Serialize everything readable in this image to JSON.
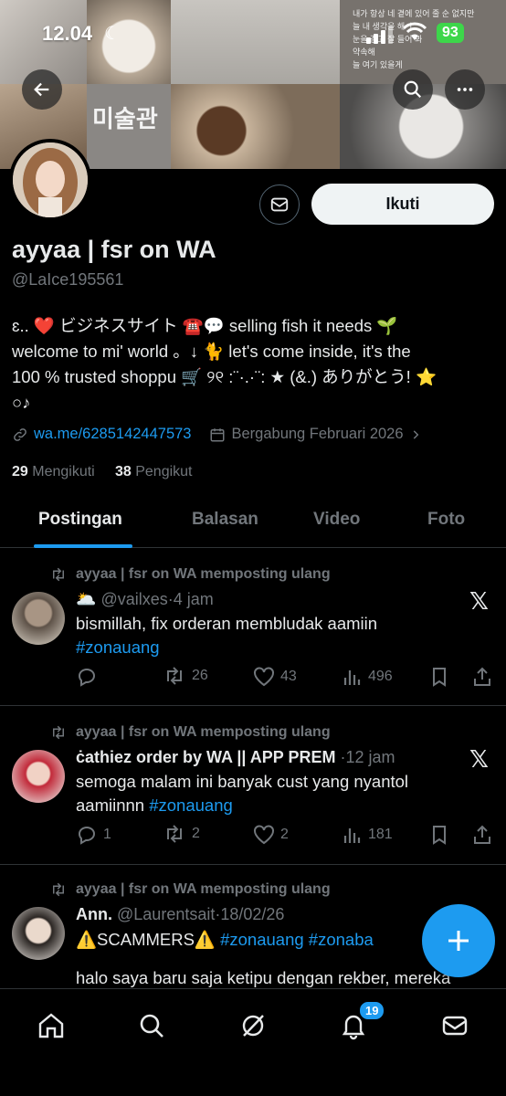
{
  "status_bar": {
    "time": "12.04",
    "battery": "93"
  },
  "banner": {
    "overlay_texts": [
      "내가 항상 네 곁에 있어 줄 순 없지만",
      "늘 내 생각을 해 ㅣ",
      "눈을 감고 잘 들어 봐",
      "약속해",
      "늘 여기 있을게"
    ],
    "sign_text": "미술관"
  },
  "profile": {
    "name": "ayyaa | fsr on WA",
    "handle": "@LaIce195561",
    "follow_label": "Ikuti",
    "bio_lines": [
      "ɛ.. ❤️ ビジネスサイト ☎️💬 selling fish it needs 🌱",
      "welcome to mi' world 。↓ 🐈 let's come inside, it's the",
      "100 % trusted shoppu 🛒 ୨୧ :¨·.·¨: ★ (&.) ありがとう! ⭐",
      "○♪"
    ],
    "link": "wa.me/6285142447573",
    "joined": "Bergabung Februari 2026",
    "following_count": "29",
    "following_label": "Mengikuti",
    "followers_count": "38",
    "followers_label": "Pengikut"
  },
  "tabs": [
    "Postingan",
    "Balasan",
    "Video",
    "Foto"
  ],
  "posts": [
    {
      "repost_label": "ayyaa | fsr on WA memposting ulang",
      "emoji": "🌥️",
      "name": "",
      "handle": "@vailxes",
      "sep": "·",
      "time": "4 jam",
      "text": "bismillah, fix orderan membludak aamiin",
      "hashtags": "#zonauang",
      "replies": "",
      "reposts": "26",
      "likes": "43",
      "views": "496"
    },
    {
      "repost_label": "ayyaa | fsr on WA memposting ulang",
      "name": "ċathiez order by WA || APP PREM",
      "handle": "",
      "sep": "·",
      "time": "12 jam",
      "text": "semoga malam ini banyak cust yang nyantol",
      "text2": "aamiinnn",
      "hashtags": "#zonauang",
      "replies": "1",
      "reposts": "2",
      "likes": "2",
      "views": "181"
    },
    {
      "repost_label": "ayyaa | fsr on WA memposting ulang",
      "name": "Ann.",
      "handle": "@Laurentsait",
      "sep": "·",
      "time": "18/02/26",
      "text": "⚠️SCAMMERS⚠️",
      "hashtags": "#zonauang #zonaba",
      "text2": "halo saya baru saja ketipu dengan rekber, mereka"
    }
  ],
  "nav": {
    "notification_count": "19"
  },
  "colors": {
    "accent": "#1d9bf0",
    "background": "#000000",
    "muted": "#71767b"
  }
}
